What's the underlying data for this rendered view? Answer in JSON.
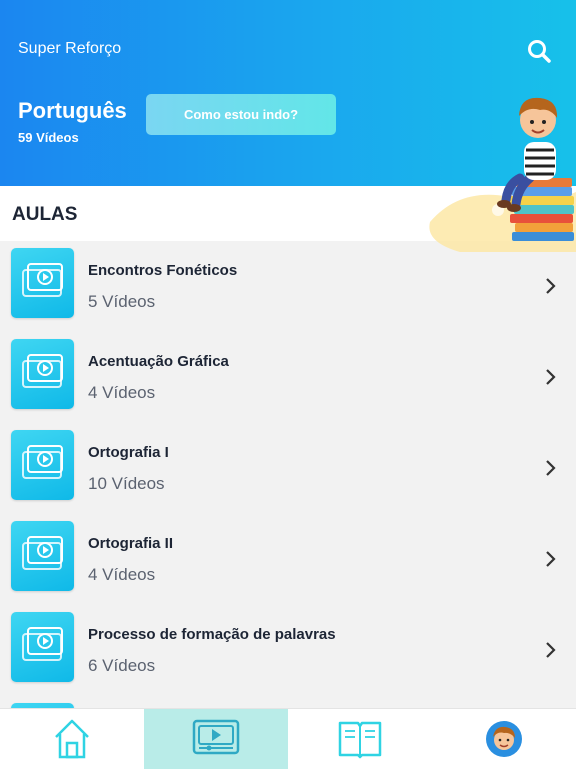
{
  "header": {
    "app_title": "Super Reforço",
    "subject": "Português",
    "video_count": "59 Vídeos",
    "progress_button": "Como estou indo?"
  },
  "section": {
    "title": "AULAS"
  },
  "lessons": [
    {
      "title": "Encontros Fonéticos",
      "videos": "5 Vídeos"
    },
    {
      "title": "Acentuação Gráfica",
      "videos": "4 Vídeos"
    },
    {
      "title": "Ortografia I",
      "videos": "10 Vídeos"
    },
    {
      "title": "Ortografia II",
      "videos": "4 Vídeos"
    },
    {
      "title": "Processo de formação de palavras",
      "videos": "6 Vídeos"
    }
  ],
  "tabs": [
    {
      "icon": "home-icon",
      "active": false
    },
    {
      "icon": "video-player-icon",
      "active": true
    },
    {
      "icon": "book-icon",
      "active": false
    },
    {
      "icon": "avatar-icon",
      "active": false
    }
  ],
  "colors": {
    "header_start": "#1b86f0",
    "header_end": "#17c1ea",
    "accent": "#2fd3e3",
    "active_tab": "#b9ece8"
  }
}
